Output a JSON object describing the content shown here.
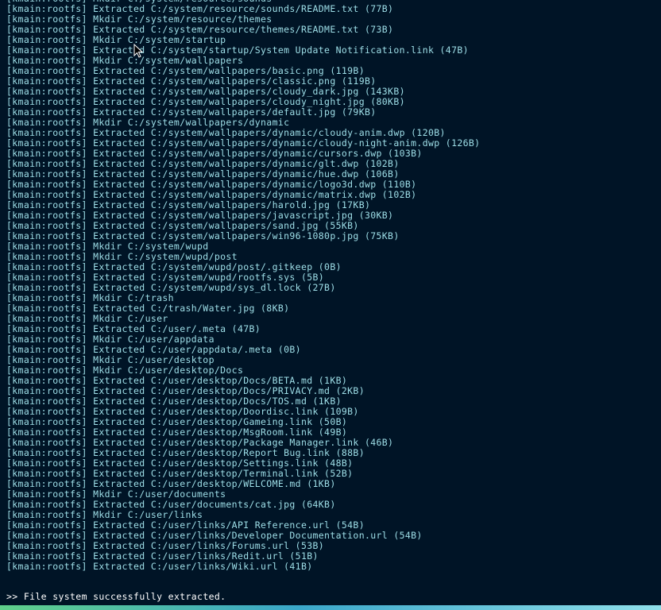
{
  "terminal": {
    "lines": [
      "[kmain:rootfs] Mkdir C:/system/resource/sounds",
      "[kmain:rootfs] Extracted C:/system/resource/sounds/README.txt (77B)",
      "[kmain:rootfs] Mkdir C:/system/resource/themes",
      "[kmain:rootfs] Extracted C:/system/resource/themes/README.txt (73B)",
      "[kmain:rootfs] Mkdir C:/system/startup",
      "[kmain:rootfs] Extracted C:/system/startup/System Update Notification.link (47B)",
      "[kmain:rootfs] Mkdir C:/system/wallpapers",
      "[kmain:rootfs] Extracted C:/system/wallpapers/basic.png (119B)",
      "[kmain:rootfs] Extracted C:/system/wallpapers/classic.png (119B)",
      "[kmain:rootfs] Extracted C:/system/wallpapers/cloudy_dark.jpg (143KB)",
      "[kmain:rootfs] Extracted C:/system/wallpapers/cloudy_night.jpg (80KB)",
      "[kmain:rootfs] Extracted C:/system/wallpapers/default.jpg (79KB)",
      "[kmain:rootfs] Mkdir C:/system/wallpapers/dynamic",
      "[kmain:rootfs] Extracted C:/system/wallpapers/dynamic/cloudy-anim.dwp (120B)",
      "[kmain:rootfs] Extracted C:/system/wallpapers/dynamic/cloudy-night-anim.dwp (126B)",
      "[kmain:rootfs] Extracted C:/system/wallpapers/dynamic/cursors.dwp (103B)",
      "[kmain:rootfs] Extracted C:/system/wallpapers/dynamic/glt.dwp (102B)",
      "[kmain:rootfs] Extracted C:/system/wallpapers/dynamic/hue.dwp (106B)",
      "[kmain:rootfs] Extracted C:/system/wallpapers/dynamic/logo3d.dwp (110B)",
      "[kmain:rootfs] Extracted C:/system/wallpapers/dynamic/matrix.dwp (102B)",
      "[kmain:rootfs] Extracted C:/system/wallpapers/harold.jpg (17KB)",
      "[kmain:rootfs] Extracted C:/system/wallpapers/javascript.jpg (30KB)",
      "[kmain:rootfs] Extracted C:/system/wallpapers/sand.jpg (55KB)",
      "[kmain:rootfs] Extracted C:/system/wallpapers/win96-1080p.jpg (75KB)",
      "[kmain:rootfs] Mkdir C:/system/wupd",
      "[kmain:rootfs] Mkdir C:/system/wupd/post",
      "[kmain:rootfs] Extracted C:/system/wupd/post/.gitkeep (0B)",
      "[kmain:rootfs] Extracted C:/system/wupd/rootfs.sys (5B)",
      "[kmain:rootfs] Extracted C:/system/wupd/sys_dl.lock (27B)",
      "[kmain:rootfs] Mkdir C:/trash",
      "[kmain:rootfs] Extracted C:/trash/Water.jpg (8KB)",
      "[kmain:rootfs] Mkdir C:/user",
      "[kmain:rootfs] Extracted C:/user/.meta (47B)",
      "[kmain:rootfs] Mkdir C:/user/appdata",
      "[kmain:rootfs] Extracted C:/user/appdata/.meta (0B)",
      "[kmain:rootfs] Mkdir C:/user/desktop",
      "[kmain:rootfs] Mkdir C:/user/desktop/Docs",
      "[kmain:rootfs] Extracted C:/user/desktop/Docs/BETA.md (1KB)",
      "[kmain:rootfs] Extracted C:/user/desktop/Docs/PRIVACY.md (2KB)",
      "[kmain:rootfs] Extracted C:/user/desktop/Docs/TOS.md (1KB)",
      "[kmain:rootfs] Extracted C:/user/desktop/Doordisc.link (109B)",
      "[kmain:rootfs] Extracted C:/user/desktop/Gameing.link (50B)",
      "[kmain:rootfs] Extracted C:/user/desktop/MsgRoom.link (49B)",
      "[kmain:rootfs] Extracted C:/user/desktop/Package Manager.link (46B)",
      "[kmain:rootfs] Extracted C:/user/desktop/Report Bug.link (88B)",
      "[kmain:rootfs] Extracted C:/user/desktop/Settings.link (48B)",
      "[kmain:rootfs] Extracted C:/user/desktop/Terminal.link (52B)",
      "[kmain:rootfs] Extracted C:/user/desktop/WELCOME.md (1KB)",
      "[kmain:rootfs] Mkdir C:/user/documents",
      "[kmain:rootfs] Extracted C:/user/documents/cat.jpg (64KB)",
      "[kmain:rootfs] Mkdir C:/user/links",
      "[kmain:rootfs] Extracted C:/user/links/API Reference.url (54B)",
      "[kmain:rootfs] Extracted C:/user/links/Developer Documentation.url (54B)",
      "[kmain:rootfs] Extracted C:/user/links/Forums.url (53B)",
      "[kmain:rootfs] Extracted C:/user/links/Redit.url (51B)",
      "[kmain:rootfs] Extracted C:/user/links/Wiki.url (41B)"
    ],
    "prompt_symbol": ">>",
    "final_message": "File system successfully extracted."
  },
  "colors": {
    "background": "#001426",
    "text": "#9edfe8",
    "prompt": "#ffffff"
  }
}
